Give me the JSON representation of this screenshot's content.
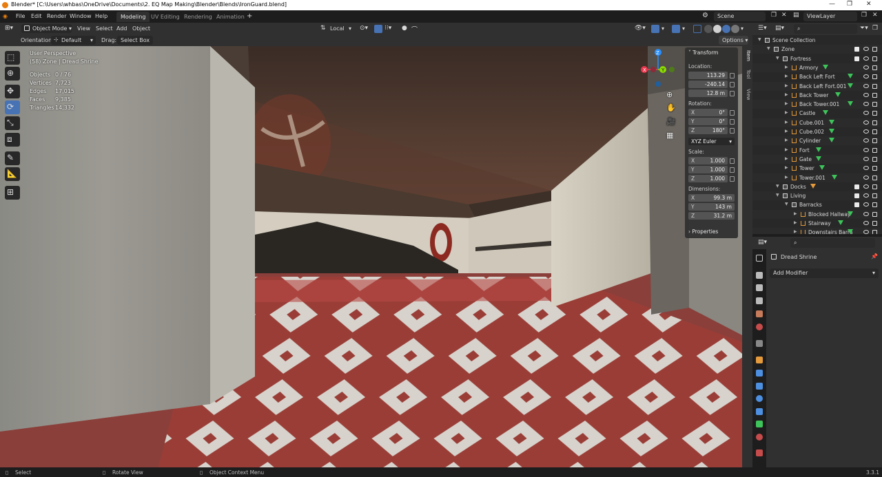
{
  "window": {
    "title": "Blender* [C:\\Users\\whbas\\OneDrive\\Documents\\2. EQ Map Making\\Blender\\Blends\\IronGuard.blend]",
    "controls": [
      "—",
      "❐",
      "✕"
    ]
  },
  "menu": {
    "items": [
      "File",
      "Edit",
      "Render",
      "Window",
      "Help"
    ]
  },
  "workspaces": {
    "tabs": [
      "Modeling",
      "UV Editing",
      "Rendering",
      "Animation"
    ],
    "active": "Modeling",
    "add": "+"
  },
  "scene_selector": {
    "value": "Scene"
  },
  "viewlayer_selector": {
    "value": "ViewLayer"
  },
  "viewport_header": {
    "mode": "Object Mode",
    "menus": [
      "View",
      "Select",
      "Add",
      "Object"
    ],
    "pivot": "Local"
  },
  "tool_settings": {
    "orientation_label": "Orientation:",
    "orientation_value": "Default",
    "drag_label": "Drag:",
    "drag_value": "Select Box",
    "options": "Options"
  },
  "viewport_overlay": {
    "perspective": "User Perspective",
    "context": "(58) Zone | Dread Shrine",
    "stats": [
      {
        "label": "Objects",
        "value": "0 / 76"
      },
      {
        "label": "Vertices",
        "value": "7,723"
      },
      {
        "label": "Edges",
        "value": "17,015"
      },
      {
        "label": "Faces",
        "value": "9,385"
      },
      {
        "label": "Triangles",
        "value": "14,332"
      }
    ]
  },
  "gizmo": {
    "x": "X",
    "y": "Y",
    "z": "Z"
  },
  "npanel": {
    "tabs": [
      "Item",
      "Tool",
      "View"
    ],
    "transform_title": "Transform",
    "location_label": "Location:",
    "location": [
      "113.29",
      "-240.14",
      "12.8 m"
    ],
    "rotation_label": "Rotation:",
    "rotation": [
      {
        "axis": "X",
        "value": "0°"
      },
      {
        "axis": "Y",
        "value": "0°"
      },
      {
        "axis": "Z",
        "value": "180°"
      }
    ],
    "rotation_mode": "XYZ Euler",
    "scale_label": "Scale:",
    "scale": [
      {
        "axis": "X",
        "value": "1.000"
      },
      {
        "axis": "Y",
        "value": "1.000"
      },
      {
        "axis": "Z",
        "value": "1.000"
      }
    ],
    "dimensions_label": "Dimensions:",
    "dimensions": [
      {
        "axis": "X",
        "value": "99.3 m"
      },
      {
        "axis": "Y",
        "value": "143 m"
      },
      {
        "axis": "Z",
        "value": "31.2 m"
      }
    ],
    "properties_title": "Properties"
  },
  "outliner": {
    "rows": [
      {
        "label": "Scene Collection",
        "depth": 0,
        "kind": "scene"
      },
      {
        "label": "Zone",
        "depth": 1,
        "kind": "collection"
      },
      {
        "label": "Fortress",
        "depth": 2,
        "kind": "collection"
      },
      {
        "label": "Armory",
        "depth": 3,
        "kind": "mesh"
      },
      {
        "label": "Back Left Fort",
        "depth": 3,
        "kind": "mesh"
      },
      {
        "label": "Back Left Fort.001",
        "depth": 3,
        "kind": "mesh"
      },
      {
        "label": "Back Tower",
        "depth": 3,
        "kind": "mesh"
      },
      {
        "label": "Back Tower.001",
        "depth": 3,
        "kind": "mesh"
      },
      {
        "label": "Castle",
        "depth": 3,
        "kind": "mesh"
      },
      {
        "label": "Cube.001",
        "depth": 3,
        "kind": "mesh"
      },
      {
        "label": "Cube.002",
        "depth": 3,
        "kind": "mesh"
      },
      {
        "label": "Cylinder",
        "depth": 3,
        "kind": "mesh"
      },
      {
        "label": "Fort",
        "depth": 3,
        "kind": "mesh"
      },
      {
        "label": "Gate",
        "depth": 3,
        "kind": "mesh"
      },
      {
        "label": "Tower",
        "depth": 3,
        "kind": "mesh"
      },
      {
        "label": "Tower.001",
        "depth": 3,
        "kind": "mesh"
      },
      {
        "label": "Docks",
        "depth": 2,
        "kind": "collection"
      },
      {
        "label": "Living",
        "depth": 2,
        "kind": "collection"
      },
      {
        "label": "Barracks",
        "depth": 3,
        "kind": "collection"
      },
      {
        "label": "Blocked Hallway",
        "depth": 4,
        "kind": "mesh"
      },
      {
        "label": "Stairway",
        "depth": 4,
        "kind": "mesh"
      },
      {
        "label": "Downstairs Barra",
        "depth": 4,
        "kind": "mesh"
      }
    ]
  },
  "properties": {
    "object_name": "Dread Shrine",
    "add_modifier": "Add Modifier"
  },
  "statusbar": {
    "select": "Select",
    "rotate": "Rotate View",
    "context_menu": "Object Context Menu",
    "version": "3.3.1"
  },
  "colors": {
    "accent": "#4772b3",
    "header": "#303030",
    "background": "#1d1d1d",
    "axis_x": "#e8384f",
    "axis_y": "#8bdc00",
    "axis_z": "#2890ff"
  }
}
